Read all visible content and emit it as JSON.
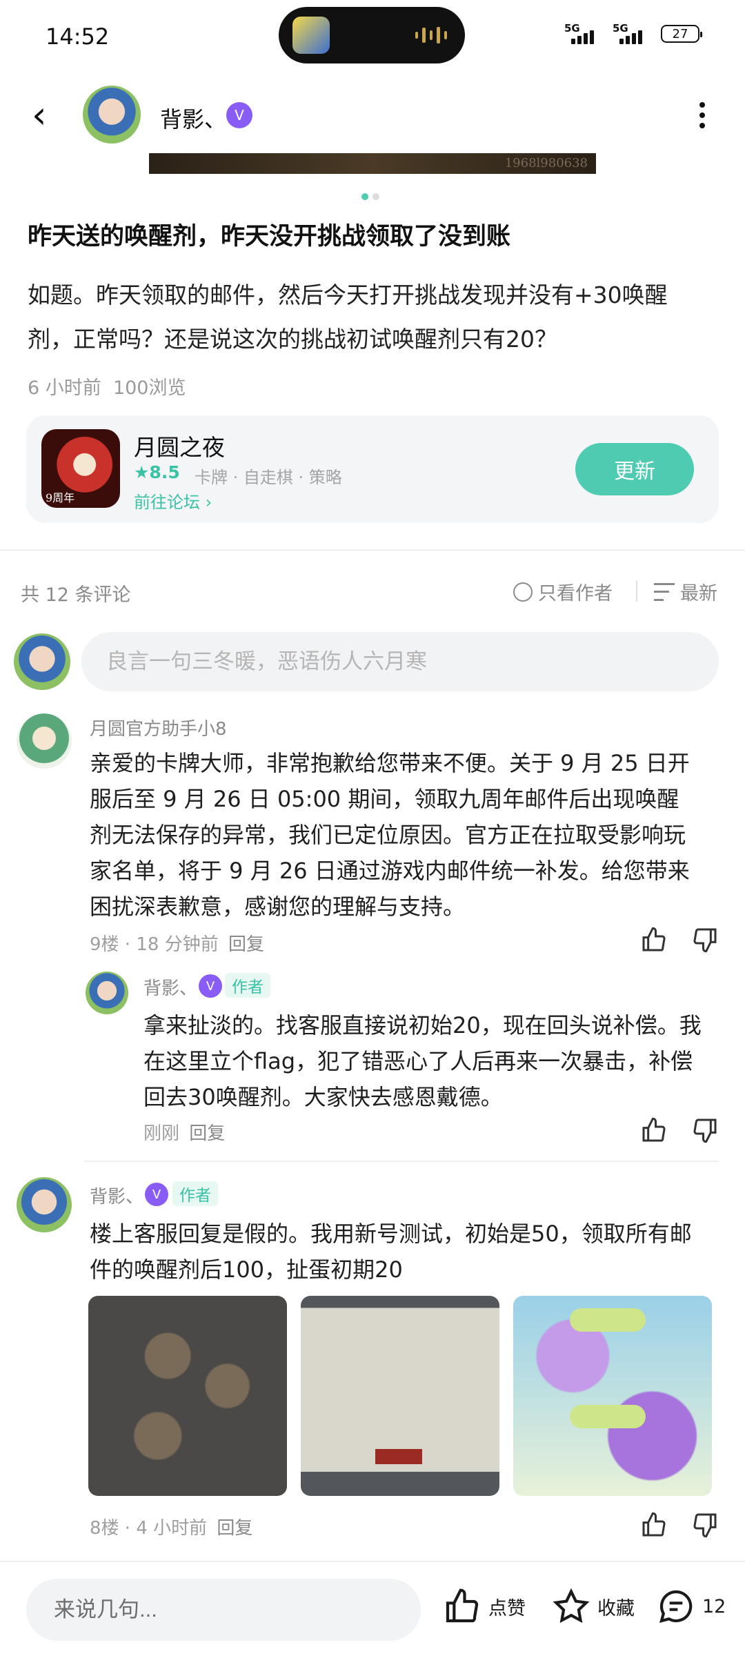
{
  "status_bar": {
    "time": "14:52",
    "battery": "27",
    "signal_1": "5G",
    "signal_2": "5G"
  },
  "header": {
    "author_name": "背影、",
    "verified_badge": "V"
  },
  "post": {
    "image_caption": "1968l980638",
    "title": "昨天送的唤醒剂，昨天没开挑战领取了没到账",
    "body_line1": "如题。昨天领取的邮件，然后今天打开挑战发现并没有+30唤醒",
    "body_line2": "剂，正常吗？还是说这次的挑战初试唤醒剂只有20？",
    "time": "6 小时前",
    "views": "100浏览"
  },
  "game_card": {
    "icon_label": "9周年",
    "name": "月圆之夜",
    "rating": "8.5",
    "tags": "卡牌 · 自走棋 · 策略",
    "forum_link": "前往论坛",
    "update_label": "更新"
  },
  "comments_header": {
    "count": "共 12 条评论",
    "only_author": "只看作者",
    "sort": "最新"
  },
  "comment_input": {
    "placeholder": "良言一句三冬暖，恶语伤人六月寒"
  },
  "comments": [
    {
      "name": "月圆官方助手小8",
      "lines": [
        "亲爱的卡牌大师，非常抱歉给您带来不便。关于 9 月 25 日开",
        "服后至 9 月 26 日 05:00 期间，领取九周年邮件后出现唤醒",
        "剂无法保存的异常，我们已定位原因。官方正在拉取受影响玩",
        "家名单，将于 9 月 26 日通过游戏内邮件统一补发。给您带来",
        "困扰深表歉意，感谢您的理解与支持。"
      ],
      "floor": "9楼",
      "time": "18 分钟前",
      "reply": "回复",
      "sub_reply": {
        "name": "背影、",
        "author_tag": "作者",
        "lines": [
          "拿来扯淡的。找客服直接说初始20，现在回头说补偿。我",
          "在这里立个flag，犯了错恶心了人后再来一次暴击，补偿",
          "回去30唤醒剂。大家快去感恩戴德。"
        ],
        "time": "刚刚",
        "reply": "回复"
      }
    },
    {
      "name": "背影、",
      "author_tag": "作者",
      "lines": [
        "楼上客服回复是假的。我用新号测试，初始是50，领取所有邮",
        "件的唤醒剂后100，扯蛋初期20"
      ],
      "floor": "8楼",
      "time": "4 小时前",
      "reply": "回复"
    }
  ],
  "bottom_bar": {
    "input_placeholder": "来说几句...",
    "like": "点赞",
    "favorite": "收藏",
    "comment_count": "12"
  },
  "colors": {
    "accent": "#4fcbb1",
    "verified": "#8a5cf6",
    "muted": "#8a8a8a"
  }
}
